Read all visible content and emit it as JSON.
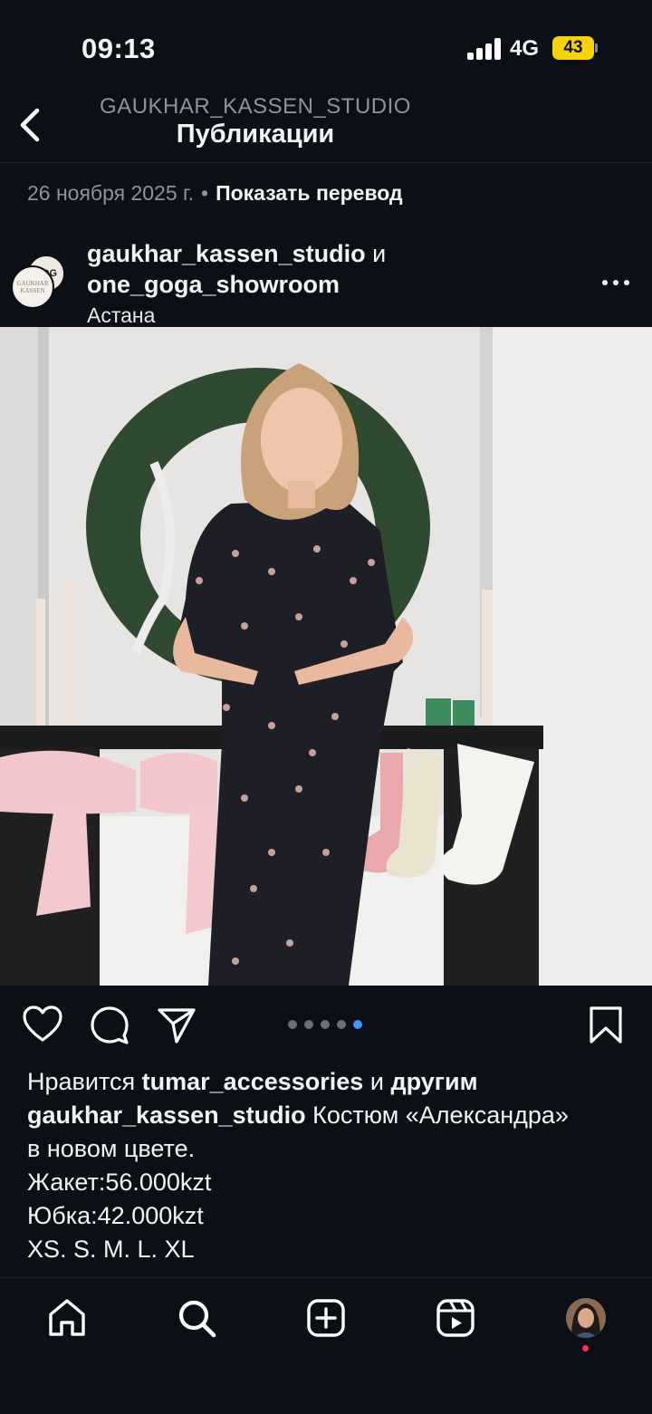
{
  "status_bar": {
    "time": "09:13",
    "network": "4G",
    "battery": "43",
    "battery_color": "#f5d30a"
  },
  "header": {
    "username": "GAUKHAR_KASSEN_STUDIO",
    "title": "Публикации",
    "back_icon": "chevron-left-icon"
  },
  "previous_post": {
    "date": "26 ноября 2025 г.",
    "separator": "•",
    "translate_label": "Показать перевод"
  },
  "post": {
    "account_primary": "gaukhar_kassen_studio",
    "conjunction": "и",
    "account_collab": "one_goga_showroom",
    "location": "Астана",
    "avatar_text_top": "GAUKHAR",
    "avatar_text_bottom": "KASSEN",
    "carousel": {
      "count": 5,
      "active_index": 4
    }
  },
  "actions": {
    "like_icon": "heart-icon",
    "comment_icon": "comment-icon",
    "share_icon": "send-icon",
    "save_icon": "bookmark-icon",
    "active_dot_color": "#3a97f5"
  },
  "likes": {
    "prefix": "Нравится",
    "user": "tumar_accessories",
    "suffix": "и",
    "others": "другим"
  },
  "caption": {
    "author": "gaukhar_kassen_studio",
    "line1_text": "Костюм «Александра»",
    "line2": "в новом цвете.",
    "line3": "Жакет:56.000kzt",
    "line4": "Юбка:42.000kzt",
    "line5": "XS. S. M. L. XL"
  },
  "bottom_nav": {
    "items": [
      "home-icon",
      "search-icon",
      "create-icon",
      "reels-icon",
      "profile-avatar"
    ],
    "notification_color": "#ff2d55"
  }
}
